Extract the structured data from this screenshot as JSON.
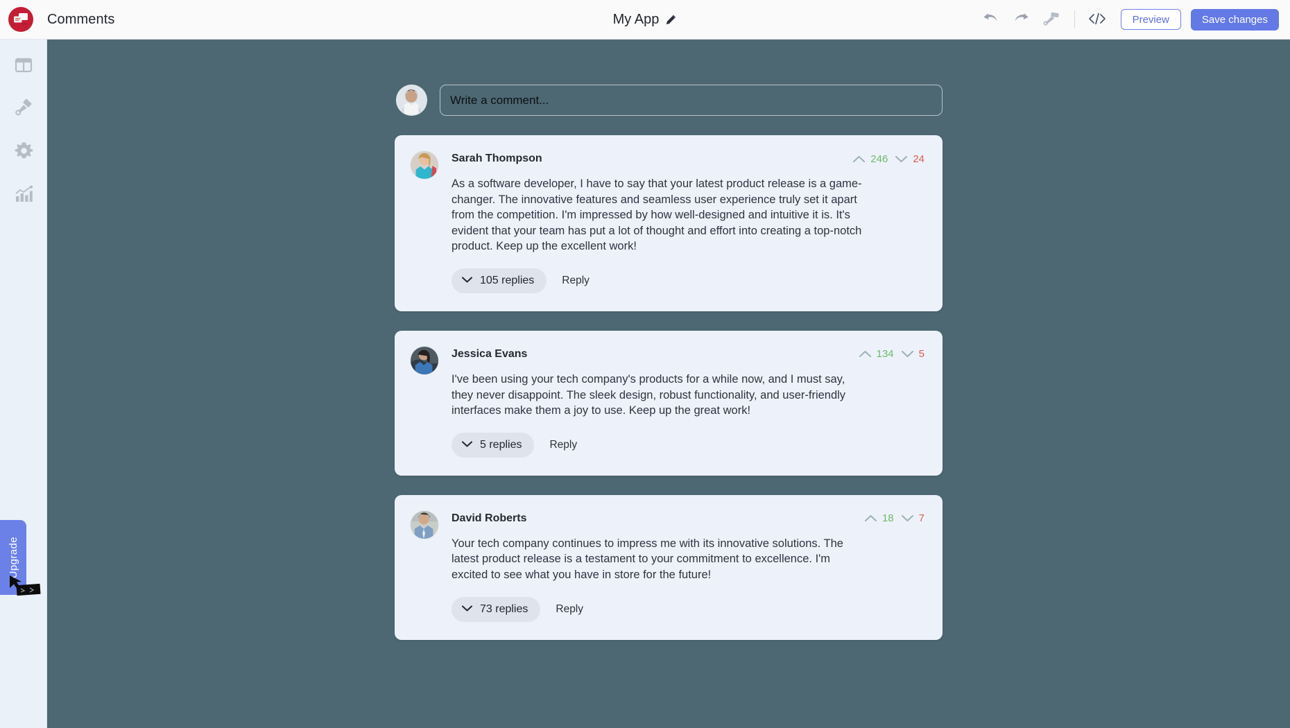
{
  "topbar": {
    "logo_icon": "comments-logo-icon",
    "title": "Comments",
    "app_name": "My App",
    "edit_icon": "pencil-icon",
    "undo_icon": "undo-icon",
    "redo_icon": "redo-icon",
    "brush_icon": "paint-roller-icon",
    "code_icon": "code-brackets-icon",
    "preview_label": "Preview",
    "save_label": "Save changes",
    "accent_color": "#6279e6",
    "logo_color": "#c41e35"
  },
  "sidebar": {
    "items": [
      {
        "icon": "layout-grid-icon",
        "name": "layout"
      },
      {
        "icon": "paintbrush-icon",
        "name": "design"
      },
      {
        "icon": "gear-icon",
        "name": "settings"
      },
      {
        "icon": "bar-chart-icon",
        "name": "analytics"
      }
    ],
    "upgrade_label": "Upgrade",
    "upgrade_color": "#6b81e8"
  },
  "canvas": {
    "background_color": "#4d6873",
    "card_color": "#edf2fa"
  },
  "composer": {
    "avatar": "user-avatar",
    "placeholder": "Write a comment...",
    "value": ""
  },
  "comments": [
    {
      "author": "Sarah Thompson",
      "avatar": "avatar-sarah",
      "upvotes": "246",
      "downvotes": "24",
      "text": "As a software developer, I have to say that your latest product release is a game-changer. The innovative features and seamless user experience truly set it apart from the competition. I'm impressed by how well-designed and intuitive it is. It's evident that your team has put a lot of thought and effort into creating a top-notch product. Keep up the excellent work!",
      "replies_label": "105 replies",
      "reply_label": "Reply"
    },
    {
      "author": "Jessica Evans",
      "avatar": "avatar-jessica",
      "upvotes": "134",
      "downvotes": "5",
      "text": "I've been using your tech company's products for a while now, and I must say, they never disappoint. The sleek design, robust functionality, and user-friendly interfaces make them a joy to use. Keep up the great work!",
      "replies_label": "5 replies",
      "reply_label": "Reply"
    },
    {
      "author": "David Roberts",
      "avatar": "avatar-david",
      "upvotes": "18",
      "downvotes": "7",
      "text": "Your tech company continues to impress me with its innovative solutions. The latest product release is a testament to your commitment to excellence. I'm excited to see what you have in store for the future!",
      "replies_label": "73 replies",
      "reply_label": "Reply"
    }
  ]
}
